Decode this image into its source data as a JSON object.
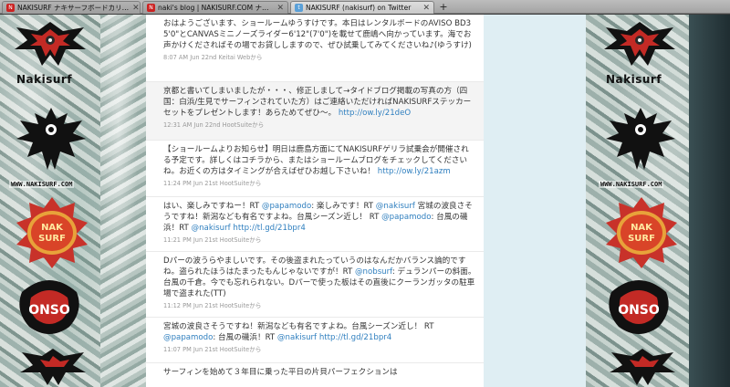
{
  "browser": {
    "tabs": [
      {
        "title": "NAKISURF ナキサーフボードカリ…",
        "favicon_color": "#cc2222"
      },
      {
        "title": "naki's blog | NAKISURF.COM ナ…",
        "favicon_color": "#cc2222"
      },
      {
        "title": "NAKISURF (nakisurf) on Twitter",
        "favicon_color": "#5aa0d8"
      }
    ],
    "new_tab_label": "+"
  },
  "branding": {
    "wordmark": "Nakisurf",
    "url": "WWW.NAKISURF.COM",
    "badge_text": "NAK SURF"
  },
  "tweets": [
    {
      "text": "おはようございます、ショールームゆうすけです。本日はレンタルボードのAVISO BD3 5'0\"とCANVASミニノーズライダー6'12\"(7'0\")を載せて鹿嶋へ向かっています。海でお声かけくださればその場でお貸ししますので、ぜひ試乗してみてくださいね♪(ゆうすけ)",
      "link": "",
      "meta": "8:07 AM Jun 22nd Keitai Webから"
    },
    {
      "text": "京都と書いてしまいましたが・・・、修正しまして→タイドブログ掲載の写真の方（四国：白浜/生見でサーフィンされていた方）はご連絡いただければNAKISURFステッカーセットをプレゼントします！あらためてぜひ〜。",
      "link": "http://ow.ly/21deO",
      "meta": "12:31 AM Jun 22nd HootSuiteから"
    },
    {
      "text": "【ショールームよりお知らせ】明日は鹿島方面にてNAKISURFゲリラ試乗会が開催される予定です。詳しくはコチラから、またはショールームブログをチェックしてくださいね。お近くの方はタイミングが合えばぜひお越し下さいね！",
      "link": "http://ow.ly/21azm",
      "meta": "11:24 PM Jun 21st HootSuiteから"
    },
    {
      "text_html": "はい、楽しみですねー！RT <a>@papamodo</a>: 楽しみです！RT <a>@nakisurf</a> 宮城の波良さそうですね！新潟なども有名ですよね。台風シーズン近し！ RT <a>@papamodo</a>: 台風の磯浜！RT <a>@nakisurf</a> <a>http://tl.gd/21bpr4</a>",
      "meta": "11:21 PM Jun 21st HootSuiteから"
    },
    {
      "text_html": "Dパーの波うらやましいです。その後盗まれたっていうのはなんだかバランス論的ですね。盗られたほうはたまったもんじゃないですが！RT <a>@nobsurf</a>: デュランパーの斜面。台風の千倉。今でも忘れられない。Dパーで使った板はその直後にクーランガッタの駐車場で盗まれた(TT)",
      "meta": "11:12 PM Jun 21st HootSuiteから"
    },
    {
      "text_html": "宮城の波良さそうですね！新潟なども有名ですよね。台風シーズン近し！ RT <a>@papamodo</a>: 台風の磯浜！RT <a>@nakisurf</a> <a>http://tl.gd/21bpr4</a>",
      "meta": "11:07 PM Jun 21st HootSuiteから"
    },
    {
      "text": "サーフィンを始めて３年目に乗った平日の片貝パーフェクションは",
      "link": "",
      "meta": ""
    }
  ]
}
